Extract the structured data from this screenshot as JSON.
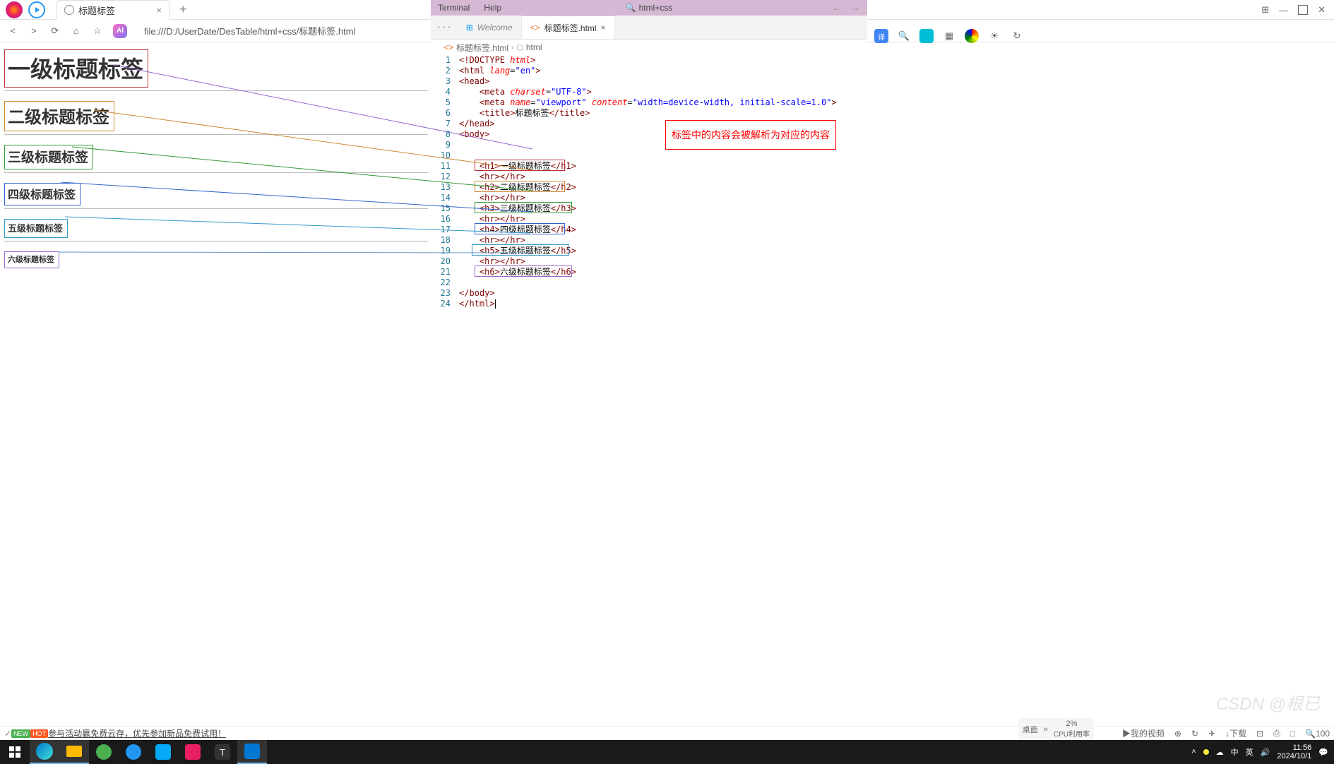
{
  "browser": {
    "tab_title": "标题标签",
    "url": "file:///D:/UserDate/DesTable/html+css/标题标签.html",
    "new_tab": "+"
  },
  "headings": {
    "h1": "一级标题标签",
    "h2": "二级标题标签",
    "h3": "三级标题标签",
    "h4": "四级标题标签",
    "h5": "五级标题标签",
    "h6": "六级标题标签"
  },
  "vscode": {
    "menu": {
      "terminal": "Terminal",
      "help": "Help"
    },
    "title_bar": "html+css",
    "tabs": {
      "welcome": "Welcome",
      "active": "标题标签.html"
    },
    "breadcrumb": {
      "file": "标题标签.html",
      "node": "html"
    },
    "line_numbers": [
      "1",
      "2",
      "3",
      "4",
      "5",
      "6",
      "7",
      "8",
      "9",
      "10",
      "11",
      "12",
      "13",
      "14",
      "15",
      "16",
      "17",
      "18",
      "19",
      "20",
      "21",
      "22",
      "23",
      "24"
    ],
    "code": {
      "l1": {
        "p1": "<!",
        "p2": "DOCTYPE",
        "p3": " html",
        "p4": ">"
      },
      "l2": {
        "p1": "<",
        "p2": "html",
        "p3": " lang",
        "p4": "=",
        "p5": "\"en\"",
        "p6": ">"
      },
      "l3": {
        "p1": "<",
        "p2": "head",
        "p3": ">"
      },
      "l4": {
        "p1": "<",
        "p2": "meta",
        "p3": " charset",
        "p4": "=",
        "p5": "\"UTF-8\"",
        "p6": ">"
      },
      "l5": {
        "p1": "<",
        "p2": "meta",
        "p3": " name",
        "p4": "=",
        "p5": "\"viewport\"",
        "p6": " content",
        "p7": "=",
        "p8": "\"width=device-width, initial-scale=1.0\"",
        "p9": ">"
      },
      "l6": {
        "p1": "<",
        "p2": "title",
        "p3": ">",
        "p4": "标题标签",
        "p5": "</",
        "p6": "title",
        "p7": ">"
      },
      "l7": {
        "p1": "</",
        "p2": "head",
        "p3": ">"
      },
      "l8": {
        "p1": "<",
        "p2": "body",
        "p3": ">"
      },
      "l11": {
        "p1": "<",
        "p2": "h1",
        "p3": ">",
        "p4": "一级标题标签",
        "p5": "</",
        "p6": "h1",
        "p7": ">"
      },
      "l12": {
        "p1": "<",
        "p2": "hr",
        "p3": ">",
        "p4": "</",
        "p5": "hr",
        "p6": ">"
      },
      "l13": {
        "p1": "<",
        "p2": "h2",
        "p3": ">",
        "p4": "二级标题标签",
        "p5": "</",
        "p6": "h2",
        "p7": ">"
      },
      "l15": {
        "p1": "<",
        "p2": "h3",
        "p3": ">",
        "p4": "三级标题标签",
        "p5": "</",
        "p6": "h3",
        "p7": ">"
      },
      "l17": {
        "p1": "<",
        "p2": "h4",
        "p3": ">",
        "p4": "四级标题标签",
        "p5": "</",
        "p6": "h4",
        "p7": ">"
      },
      "l19": {
        "p1": "<",
        "p2": "h5",
        "p3": ">",
        "p4": "五级标题标签",
        "p5": "</",
        "p6": "h5",
        "p7": ">"
      },
      "l21": {
        "p1": "<",
        "p2": "h6",
        "p3": ">",
        "p4": "六级标题标签",
        "p5": "</",
        "p6": "h6",
        "p7": ">"
      },
      "l23": {
        "p1": "</",
        "p2": "body",
        "p3": ">"
      },
      "l24": {
        "p1": "</",
        "p2": "html",
        "p3": ">"
      }
    }
  },
  "callout": "标签中的内容会被解析为对应的内容",
  "bottom": {
    "new_badge": "NEW",
    "hot_badge": "HOT",
    "promo": "参与活动赢免费云存，优先参加新品免费试用！",
    "my_video": "我的视频",
    "download": "下载"
  },
  "tray": {
    "desktop": "桌面",
    "cpu_pct": "2%",
    "cpu_label": "CPU利用率",
    "time": "11:56",
    "date": "2024/10/1",
    "count": "100"
  },
  "watermark": "CSDN @根已"
}
